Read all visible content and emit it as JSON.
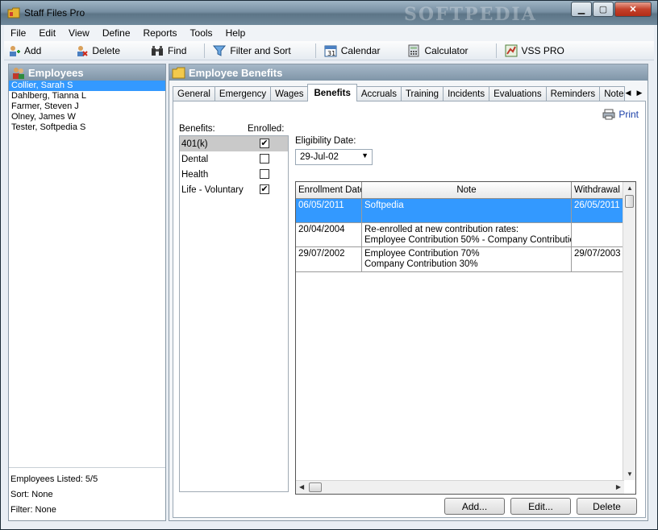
{
  "window": {
    "title": "Staff Files Pro",
    "controls": {
      "minimize": "▁",
      "maximize": "▢",
      "close": "✕"
    }
  },
  "menu": [
    "File",
    "Edit",
    "View",
    "Define",
    "Reports",
    "Tools",
    "Help"
  ],
  "toolbar": {
    "add": "Add",
    "delete": "Delete",
    "find": "Find",
    "filter_sort": "Filter and Sort",
    "calendar": "Calendar",
    "calculator": "Calculator",
    "vss_pro": "VSS PRO"
  },
  "employees_panel": {
    "title": "Employees",
    "items": [
      "Collier, Sarah S",
      "Dahlberg, Tianna L",
      "Farmer, Steven J",
      "Olney, James W",
      "Tester, Softpedia S"
    ],
    "selected_index": 0,
    "footer": {
      "listed": "Employees Listed: 5/5",
      "sort": "Sort: None",
      "filter": "Filter: None"
    }
  },
  "benefits_panel": {
    "title": "Employee Benefits",
    "tabs": [
      "General",
      "Emergency",
      "Wages",
      "Benefits",
      "Accruals",
      "Training",
      "Incidents",
      "Evaluations",
      "Reminders",
      "Notes"
    ],
    "active_tab": "Benefits",
    "print_label": "Print",
    "benefits_label": "Benefits:",
    "enrolled_label": "Enrolled:",
    "benefits": [
      {
        "name": "401(k)",
        "enrolled": true
      },
      {
        "name": "Dental",
        "enrolled": false
      },
      {
        "name": "Health",
        "enrolled": false
      },
      {
        "name": "Life - Voluntary",
        "enrolled": true
      }
    ],
    "eligibility_label": "Eligibility Date:",
    "eligibility_date": "29-Jul-02",
    "grid": {
      "columns": [
        "Enrollment Date",
        "Note",
        "Withdrawal D"
      ],
      "rows": [
        {
          "enrollment": "06/05/2011",
          "note1": "Softpedia",
          "note2": "",
          "withdrawal": "26/05/2011"
        },
        {
          "enrollment": "20/04/2004",
          "note1": "Re-enrolled at new contribution rates:",
          "note2": "Employee Contribution 50% - Company Contribution",
          "withdrawal": ""
        },
        {
          "enrollment": "29/07/2002",
          "note1": "Employee Contribution 70%",
          "note2": "Company Contribution 30%",
          "withdrawal": "29/07/2003"
        }
      ]
    },
    "buttons": {
      "add": "Add...",
      "edit": "Edit...",
      "delete": "Delete"
    }
  },
  "colors": {
    "selection": "#3399ff",
    "panel_header": "#8ea3b5"
  }
}
